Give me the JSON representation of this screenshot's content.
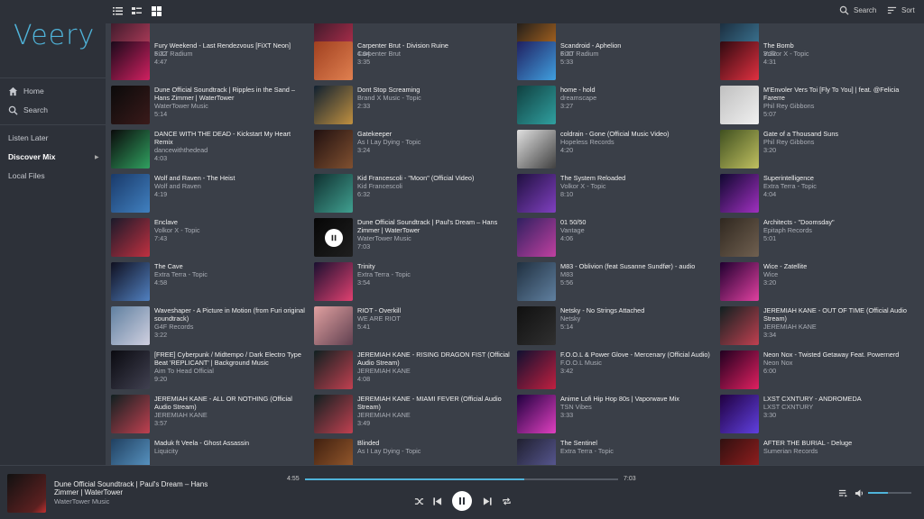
{
  "app": {
    "logo": "Veery"
  },
  "sidebar": {
    "items": [
      {
        "label": "Home",
        "icon": "home-icon"
      },
      {
        "label": "Search",
        "icon": "search-icon"
      },
      {
        "label": "Listen Later"
      },
      {
        "label": "Discover Mix",
        "active": true
      },
      {
        "label": "Local Files"
      }
    ]
  },
  "topbar": {
    "search_label": "Search",
    "sort_label": "Sort"
  },
  "colors": {
    "accent": "#4fb3d9",
    "background": "#2d3139",
    "grid": "#3a3f48"
  },
  "grid": {
    "columns": [
      [
        {
          "title": "",
          "artist": "",
          "duration": "5:32",
          "c": [
            "#3a1a2a",
            "#c04060"
          ]
        },
        {
          "title": "Fury Weekend - Last Rendezvous [FiXT Neon]",
          "artist": "FiXT Radium",
          "duration": "4:47",
          "c": [
            "#1a0a1a",
            "#d02060"
          ]
        },
        {
          "title": "Dune Official Soundtrack | Ripples in the Sand – Hans Zimmer | WaterTower",
          "artist": "WaterTower Music",
          "duration": "5:14",
          "c": [
            "#0a0a0a",
            "#3a1a1a"
          ]
        },
        {
          "title": "DANCE WITH THE DEAD - Kickstart My Heart Remix",
          "artist": "dancewiththedead",
          "duration": "4:03",
          "c": [
            "#0a0a0a",
            "#30a060"
          ]
        },
        {
          "title": "Wolf and Raven - The Heist",
          "artist": "Wolf and Raven",
          "duration": "4:19",
          "c": [
            "#1a3a6a",
            "#4080c0"
          ]
        },
        {
          "title": "Enclave",
          "artist": "Volkor X - Topic",
          "duration": "7:43",
          "c": [
            "#1a1a2a",
            "#c03040"
          ]
        },
        {
          "title": "The Cave",
          "artist": "Extra Terra - Topic",
          "duration": "4:58",
          "c": [
            "#101020",
            "#5080c0"
          ]
        },
        {
          "title": "Waveshaper - A Picture in Motion (from Furi original soundtrack)",
          "artist": "G4F Records",
          "duration": "3:22",
          "c": [
            "#6080a0",
            "#d0d0e0"
          ]
        },
        {
          "title": "[FREE] Cyberpunk / Midtempo / Dark Electro Type Beat 'REPLICANT' | Background Music",
          "artist": "Aim To Head Official",
          "duration": "9:20",
          "c": [
            "#0a0a10",
            "#404050"
          ]
        },
        {
          "title": "JEREMIAH KANE - ALL OR NOTHING (Official Audio Stream)",
          "artist": "JEREMIAH KANE",
          "duration": "3:57",
          "c": [
            "#102020",
            "#c04050"
          ]
        },
        {
          "title": "Maduk ft Veela - Ghost Assassin",
          "artist": "Liquicity",
          "duration": "",
          "c": [
            "#204060",
            "#60a0d0"
          ]
        }
      ],
      [
        {
          "title": "",
          "artist": "",
          "duration": "4:04",
          "c": [
            "#3a1a2a",
            "#c03050"
          ]
        },
        {
          "title": "Carpenter Brut - Division Ruine",
          "artist": "Carpenter Brut",
          "duration": "3:35",
          "c": [
            "#a04020",
            "#e08050"
          ]
        },
        {
          "title": "Dont Stop Screaming",
          "artist": "Brand X Music - Topic",
          "duration": "2:33",
          "c": [
            "#102030",
            "#c09040"
          ]
        },
        {
          "title": "Gatekeeper",
          "artist": "As I Lay Dying - Topic",
          "duration": "3:24",
          "c": [
            "#201010",
            "#805030"
          ]
        },
        {
          "title": "Kid Francescoli - \"Moon\" (Official Video)",
          "artist": "Kid Francescoli",
          "duration": "6:32",
          "c": [
            "#103030",
            "#40a090"
          ]
        },
        {
          "title": "Dune Official Soundtrack | Paul's Dream – Hans Zimmer | WaterTower",
          "artist": "WaterTower Music",
          "duration": "7:03",
          "c": [
            "#0a0a0a",
            "#303030"
          ],
          "playing": true
        },
        {
          "title": "Trinity",
          "artist": "Extra Terra - Topic",
          "duration": "3:54",
          "c": [
            "#1a1030",
            "#e04070"
          ]
        },
        {
          "title": "RIOT - Overkill",
          "artist": "WE ARE RIOT",
          "duration": "5:41",
          "c": [
            "#e0a0a0",
            "#604050"
          ]
        },
        {
          "title": "JEREMIAH KANE - RISING DRAGON FIST (Official Audio Stream)",
          "artist": "JEREMIAH KANE",
          "duration": "4:08",
          "c": [
            "#102020",
            "#c04050"
          ]
        },
        {
          "title": "JEREMIAH KANE - MIAMI FEVER (Official Audio Stream)",
          "artist": "JEREMIAH KANE",
          "duration": "3:49",
          "c": [
            "#102020",
            "#c04050"
          ]
        },
        {
          "title": "Blinded",
          "artist": "As I Lay Dying - Topic",
          "duration": "",
          "c": [
            "#402010",
            "#a06030"
          ]
        }
      ],
      [
        {
          "title": "",
          "artist": "",
          "duration": "6:20",
          "c": [
            "#1a1a1a",
            "#c07020"
          ]
        },
        {
          "title": "Scandroid - Aphelion",
          "artist": "FiXT Radium",
          "duration": "5:33",
          "c": [
            "#202060",
            "#40a0e0"
          ]
        },
        {
          "title": "home - hold",
          "artist": "dreamscape",
          "duration": "3:27",
          "c": [
            "#104040",
            "#30a0a0"
          ]
        },
        {
          "title": "coldrain - Gone (Official Music Video)",
          "artist": "Hopeless Records",
          "duration": "4:20",
          "c": [
            "#e0e0e0",
            "#404040"
          ]
        },
        {
          "title": "The System Reloaded",
          "artist": "Volkor X - Topic",
          "duration": "8:10",
          "c": [
            "#201040",
            "#8040c0"
          ]
        },
        {
          "title": "01 50/50",
          "artist": "Vantage",
          "duration": "4:06",
          "c": [
            "#302060",
            "#c040a0"
          ]
        },
        {
          "title": "M83 - Oblivion (feat Susanne Sundfør) - audio",
          "artist": "M83",
          "duration": "5:56",
          "c": [
            "#203040",
            "#6080a0"
          ]
        },
        {
          "title": "Netsky - No Strings Attached",
          "artist": "Netsky",
          "duration": "5:14",
          "c": [
            "#101010",
            "#303030"
          ]
        },
        {
          "title": "F.O.O.L & Power Glove - Mercenary (Official Audio)",
          "artist": "F.O.O.L Music",
          "duration": "3:42",
          "c": [
            "#101030",
            "#c02040"
          ]
        },
        {
          "title": "Anime Lofi Hip Hop 80s | Vaporwave Mix",
          "artist": "TSN Vibes",
          "duration": "3:33",
          "c": [
            "#200040",
            "#e040c0"
          ]
        },
        {
          "title": "The Sentinel",
          "artist": "Extra Terra - Topic",
          "duration": "",
          "c": [
            "#202030",
            "#6060a0"
          ]
        }
      ],
      [
        {
          "title": "",
          "artist": "",
          "duration": "3:32",
          "c": [
            "#1a2a3a",
            "#4080a0"
          ]
        },
        {
          "title": "The Bomb",
          "artist": "Volkor X - Topic",
          "duration": "4:31",
          "c": [
            "#300a10",
            "#e03040"
          ]
        },
        {
          "title": "M'Envoler Vers Toi [Fly To You] | feat. @Felicia Farerre",
          "artist": "Phil Rey Gibbons",
          "duration": "5:07",
          "c": [
            "#c0c0c0",
            "#f0f0f0"
          ]
        },
        {
          "title": "Gate of a Thousand Suns",
          "artist": "Phil Rey Gibbons",
          "duration": "3:20",
          "c": [
            "#405020",
            "#c0c060"
          ]
        },
        {
          "title": "Superintelligence",
          "artist": "Extra Terra - Topic",
          "duration": "4:04",
          "c": [
            "#100830",
            "#a030c0"
          ]
        },
        {
          "title": "Architects - \"Doomsday\"",
          "artist": "Epitaph Records",
          "duration": "5:01",
          "c": [
            "#302820",
            "#706050"
          ]
        },
        {
          "title": "Wice - Zatellite",
          "artist": "Wice",
          "duration": "3:20",
          "c": [
            "#200030",
            "#e040a0"
          ]
        },
        {
          "title": "JEREMIAH KANE - OUT OF TIME (Official Audio Stream)",
          "artist": "JEREMIAH KANE",
          "duration": "3:34",
          "c": [
            "#102020",
            "#c04050"
          ]
        },
        {
          "title": "Neon Nox - Twisted Getaway Feat. Powernerd",
          "artist": "Neon Nox",
          "duration": "6:00",
          "c": [
            "#200020",
            "#e02060"
          ]
        },
        {
          "title": "LXST CXNTURY - ANDROMEDA",
          "artist": "LXST CXNTURY",
          "duration": "3:30",
          "c": [
            "#200040",
            "#6040e0"
          ]
        },
        {
          "title": "AFTER THE BURIAL - Deluge",
          "artist": "Sumerian Records",
          "duration": "",
          "c": [
            "#301010",
            "#a02020"
          ]
        }
      ]
    ]
  },
  "player": {
    "title": "Dune Official Soundtrack | Paul's Dream – Hans Zimmer | WaterTower",
    "artist": "WaterTower Music",
    "elapsed": "4:55",
    "total": "7:03",
    "progress": 0.7,
    "volume": 0.45
  }
}
